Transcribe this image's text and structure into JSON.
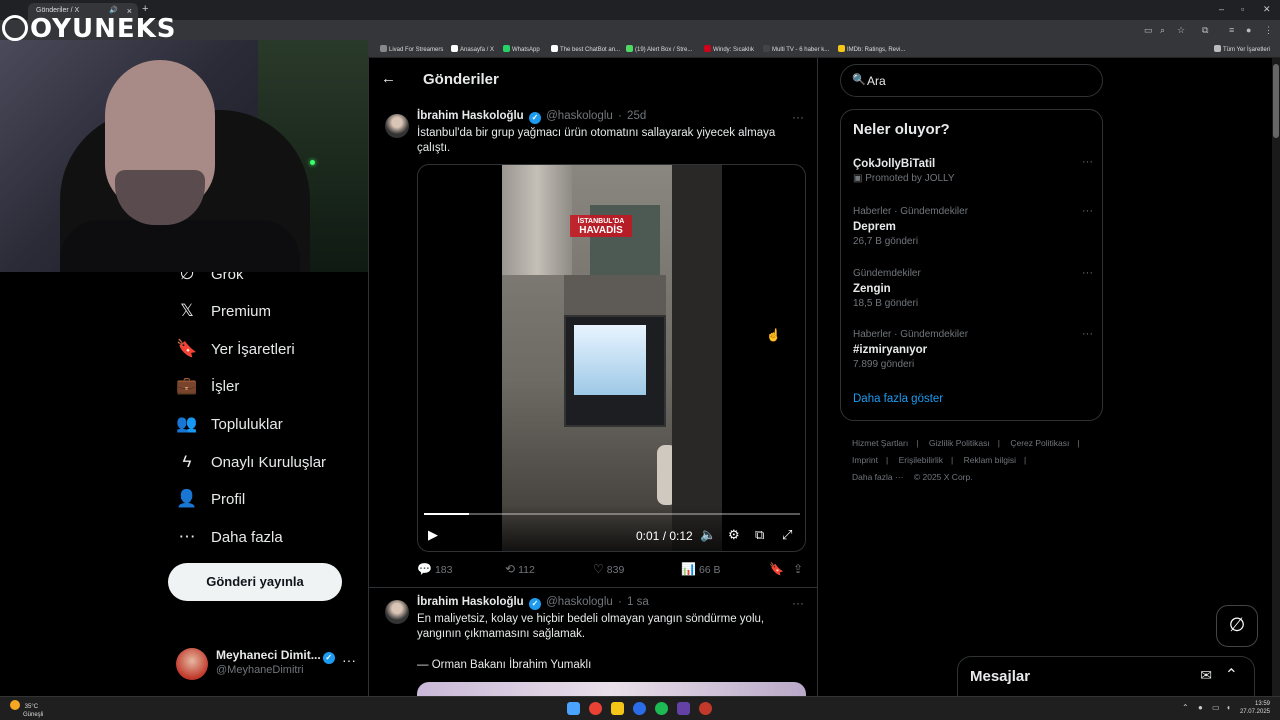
{
  "browser": {
    "tab_title": "Gönderiler / X",
    "bookmarks": [
      {
        "label": "Livad For Streamers",
        "color": "#888"
      },
      {
        "label": "Anasayfa / X",
        "color": "#fff"
      },
      {
        "label": "WhatsApp",
        "color": "#25d366"
      },
      {
        "label": "The best ChatBot an...",
        "color": "#fff"
      },
      {
        "label": "(19) Alert Box / Stre...",
        "color": "#4cd964"
      },
      {
        "label": "Windy: Sıcaklık",
        "color": "#d0021b"
      },
      {
        "label": "Multi TV - 6 haber k...",
        "color": "#444"
      },
      {
        "label": "IMDb: Ratings, Revi...",
        "color": "#f5c518"
      }
    ],
    "all_bookmarks": "Tüm Yer İşaretleri"
  },
  "overlay": {
    "logo": "OYUNEKS"
  },
  "nav": {
    "items": [
      {
        "icon": "grok-icon",
        "glyph": "∅",
        "label": "Grok"
      },
      {
        "icon": "x-logo-icon",
        "glyph": "𝕏",
        "label": "Premium"
      },
      {
        "icon": "bookmark-icon",
        "glyph": "🔖",
        "label": "Yer İşaretleri"
      },
      {
        "icon": "briefcase-icon",
        "glyph": "💼",
        "label": "İşler"
      },
      {
        "icon": "communities-icon",
        "glyph": "👥",
        "label": "Topluluklar"
      },
      {
        "icon": "lightning-icon",
        "glyph": "ϟ",
        "label": "Onaylı Kuruluşlar"
      },
      {
        "icon": "person-icon",
        "glyph": "👤",
        "label": "Profil"
      },
      {
        "icon": "more-circle-icon",
        "glyph": "⋯",
        "label": "Daha fazla"
      }
    ],
    "post_button": "Gönderi yayınla",
    "account": {
      "name": "Meyhaneci Dimit...",
      "handle": "@MeyhaneDimitri"
    }
  },
  "center": {
    "title": "Gönderiler",
    "tweets": [
      {
        "author": "İbrahim Haskoloğlu",
        "handle": "@haskologlu",
        "time": "25d",
        "text": "İstanbul'da bir grup yağmacı ürün otomatını sallayarak yiyecek almaya çalıştı.",
        "video": {
          "watermark_line1": "İSTANBUL'DA",
          "watermark_line2": "HAVADİS",
          "time": "0:01 / 0:12",
          "progress": 0.12
        },
        "replies": "183",
        "reposts": "112",
        "likes": "839",
        "views": "66 B"
      },
      {
        "author": "İbrahim Haskoloğlu",
        "handle": "@haskologlu",
        "time": "1 sa",
        "text": "En maliyetsiz, kolay ve hiçbir bedeli olmayan yangın söndürme yolu, yangının çıkmamasını sağlamak.",
        "quote": "— Orman Bakanı İbrahim Yumaklı"
      }
    ]
  },
  "right": {
    "search_placeholder": "Ara",
    "trends_title": "Neler oluyor?",
    "trends": [
      {
        "meta": "",
        "name": "ÇokJollyBiTatil",
        "sub": "Promoted by JOLLY"
      },
      {
        "meta": "Haberler · Gündemdekiler",
        "name": "Deprem",
        "sub": "26,7 B gönderi"
      },
      {
        "meta": "Gündemdekiler",
        "name": "Zengin",
        "sub": "18,5 B gönderi"
      },
      {
        "meta": "Haberler · Gündemdekiler",
        "name": "#izmiryanıyor",
        "sub": "7.899 gönderi"
      }
    ],
    "show_more": "Daha fazla göster",
    "footer": {
      "links": [
        "Hizmet Şartları",
        "Gizlilik Politikası",
        "Çerez Politikası",
        "Imprint",
        "Erişilebilirlik",
        "Reklam bilgisi",
        "Daha fazla ···"
      ],
      "copyright": "© 2025 X Corp."
    },
    "messages": "Mesajlar"
  },
  "taskbar": {
    "temp": "35°C",
    "weather": "Güneşli",
    "time": "13:59",
    "date": "27.07.2025"
  }
}
